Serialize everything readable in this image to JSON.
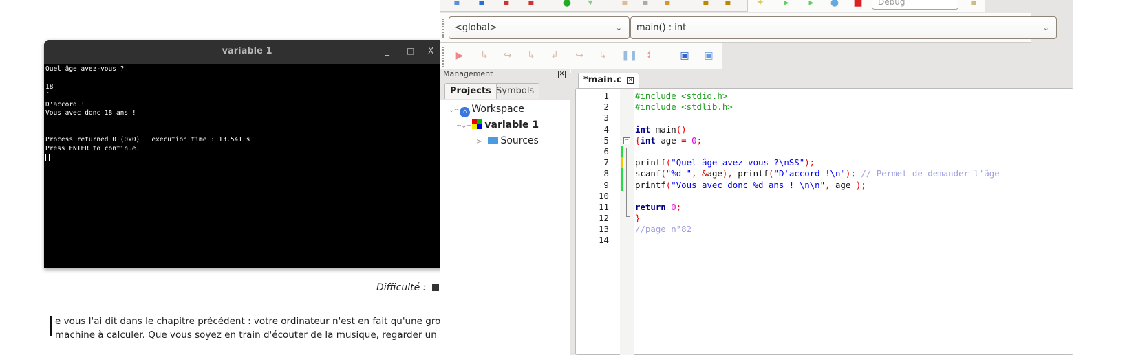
{
  "terminal": {
    "title": "variable 1",
    "lines": [
      "Quel âge avez-vous ?",
      "",
      "18",
      "´",
      "D'accord !",
      "Vous avec donc 18 ans !",
      "",
      "",
      "Process returned 0 (0x0)   execution time : 13.541 s",
      "Press ENTER to continue."
    ],
    "minimize": "_",
    "maximize": "□",
    "close": "X"
  },
  "document": {
    "difficulty_label": "Difficulté :",
    "paragraph_line1": "e  vous l'ai dit dans le chapitre précédent : votre ordinateur n'est en fait qu'une gro",
    "paragraph_line2": "machine à calculer. Que vous soyez en train d'écouter de la musique, regarder un"
  },
  "ide": {
    "build_target": "Debug",
    "scope_combo": "<global>",
    "function_combo": "main() : int",
    "management": {
      "title": "Management",
      "tabs": [
        "Projects",
        "Symbols"
      ],
      "tree": {
        "workspace": "Workspace",
        "project": "variable 1",
        "folder": "Sources"
      }
    },
    "editor_tab": "*main.c",
    "code": [
      [
        [
          "pre",
          "#include <stdio.h>"
        ]
      ],
      [
        [
          "pre",
          "#include <stdlib.h>"
        ]
      ],
      [],
      [
        [
          "kw",
          "int"
        ],
        [
          "id",
          " main"
        ],
        [
          "op",
          "()"
        ]
      ],
      [
        [
          "op",
          "{"
        ],
        [
          "kw",
          "int"
        ],
        [
          "id",
          " age "
        ],
        [
          "op",
          "="
        ],
        [
          "id",
          " "
        ],
        [
          "num",
          "0"
        ],
        [
          "op",
          ";"
        ]
      ],
      [],
      [
        [
          "id",
          "printf"
        ],
        [
          "op",
          "("
        ],
        [
          "str",
          "\"Quel âge avez-vous ?\\nSS\""
        ],
        [
          "op",
          ");"
        ]
      ],
      [
        [
          "id",
          "scanf"
        ],
        [
          "op",
          "("
        ],
        [
          "str",
          "\"%d \""
        ],
        [
          "op",
          ", &"
        ],
        [
          "id",
          "age"
        ],
        [
          "op",
          "),"
        ],
        [
          "id",
          " printf"
        ],
        [
          "op",
          "("
        ],
        [
          "str",
          "\"D'accord !\\n\""
        ],
        [
          "op",
          ");"
        ],
        [
          "id",
          " "
        ],
        [
          "cmt",
          "// Permet de demander l'âge"
        ]
      ],
      [
        [
          "id",
          "printf"
        ],
        [
          "op",
          "("
        ],
        [
          "str",
          "\"Vous avec donc %d ans ! \\n\\n\""
        ],
        [
          "op",
          ","
        ],
        [
          "id",
          " age "
        ],
        [
          "op",
          ");"
        ]
      ],
      [],
      [
        [
          "kw",
          "return"
        ],
        [
          "id",
          " "
        ],
        [
          "num",
          "0"
        ],
        [
          "op",
          ";"
        ]
      ],
      [
        [
          "op",
          "}"
        ]
      ],
      [
        [
          "cmt",
          "//page n°82"
        ]
      ],
      []
    ],
    "change_markers": {
      "6": "#22dd44",
      "7": "#f0c800",
      "8": "#22dd44",
      "9": "#22dd44"
    }
  }
}
